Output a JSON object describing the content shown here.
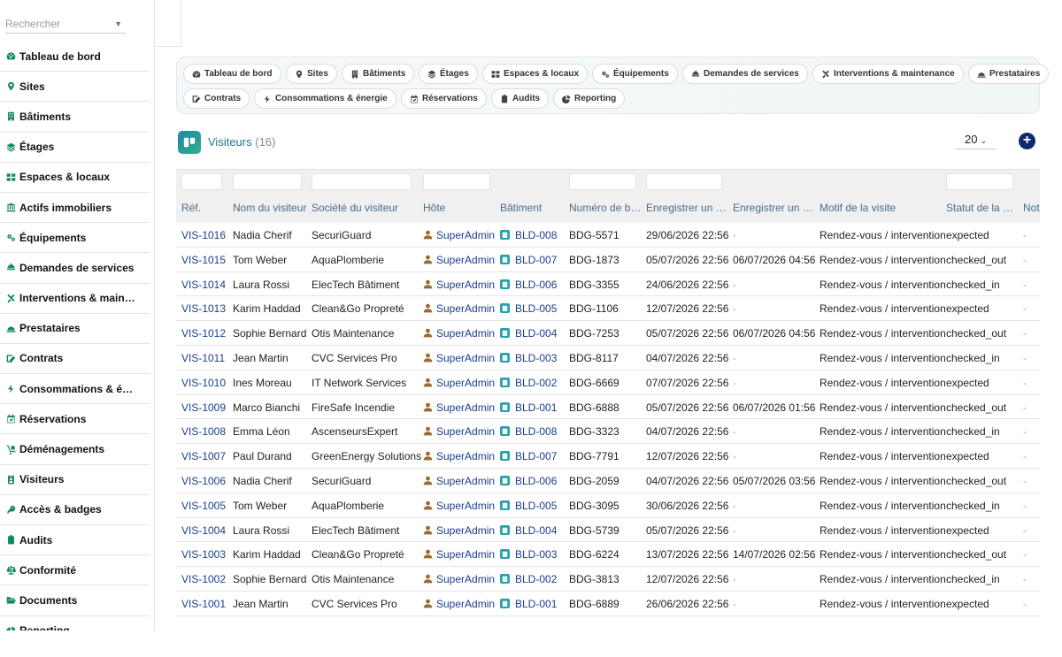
{
  "sidebar": {
    "search_placeholder": "Rechercher",
    "items": [
      {
        "label": "Tableau de bord",
        "icon": "dashboard-icon"
      },
      {
        "label": "Sites",
        "icon": "map-pin-icon"
      },
      {
        "label": "Bâtiments",
        "icon": "building-icon"
      },
      {
        "label": "Étages",
        "icon": "layers-icon"
      },
      {
        "label": "Espaces & locaux",
        "icon": "grid-icon"
      },
      {
        "label": "Actifs immobiliers",
        "icon": "bank-icon"
      },
      {
        "label": "Équipements",
        "icon": "gears-icon"
      },
      {
        "label": "Demandes de services",
        "icon": "bell-icon"
      },
      {
        "label": "Interventions & main…",
        "icon": "tools-icon"
      },
      {
        "label": "Prestataires",
        "icon": "helmet-icon"
      },
      {
        "label": "Contrats",
        "icon": "signature-icon"
      },
      {
        "label": "Consommations & é…",
        "icon": "bolt-icon"
      },
      {
        "label": "Réservations",
        "icon": "calendar-check-icon"
      },
      {
        "label": "Déménagements",
        "icon": "dolly-icon"
      },
      {
        "label": "Visiteurs",
        "icon": "id-badge-icon"
      },
      {
        "label": "Accès & badges",
        "icon": "key-icon"
      },
      {
        "label": "Audits",
        "icon": "clipboard-check-icon"
      },
      {
        "label": "Conformité",
        "icon": "scale-icon"
      },
      {
        "label": "Documents",
        "icon": "folder-open-icon"
      },
      {
        "label": "Reporting",
        "icon": "chart-pie-icon"
      }
    ]
  },
  "quicknav": {
    "items": [
      {
        "label": "Tableau de bord",
        "icon": "dashboard-icon"
      },
      {
        "label": "Sites",
        "icon": "map-pin-icon"
      },
      {
        "label": "Bâtiments",
        "icon": "building-icon"
      },
      {
        "label": "Étages",
        "icon": "layers-icon"
      },
      {
        "label": "Espaces & locaux",
        "icon": "grid-icon"
      },
      {
        "label": "Équipements",
        "icon": "gears-icon"
      },
      {
        "label": "Demandes de services",
        "icon": "bell-icon"
      },
      {
        "label": "Interventions & maintenance",
        "icon": "tools-icon"
      },
      {
        "label": "Prestataires",
        "icon": "helmet-icon"
      },
      {
        "label": "Contrats",
        "icon": "signature-icon"
      },
      {
        "label": "Consommations & énergie",
        "icon": "bolt-icon"
      },
      {
        "label": "Réservations",
        "icon": "calendar-check-icon"
      },
      {
        "label": "Audits",
        "icon": "clipboard-check-icon"
      },
      {
        "label": "Reporting",
        "icon": "chart-pie-icon"
      }
    ]
  },
  "list": {
    "title": "Visiteurs",
    "count": "(16)",
    "page_size": "20",
    "add_icon": "plus-circle-icon",
    "list_icon": "kanban-icon"
  },
  "table": {
    "columns": [
      "Réf.",
      "Nom du visiteur",
      "Société du visiteur",
      "Hôte",
      "Bâtiment",
      "Numéro de b…",
      "Enregistrer un …",
      "Enregistrer un …",
      "Motif de la visite",
      "Statut de la …",
      "Note"
    ],
    "rows": [
      [
        "VIS-1016",
        "Nadia Cherif",
        "SecuriGuard",
        "SuperAdmin",
        "BLD-008",
        "BDG-5571",
        "29/06/2026 22:56",
        "-",
        "Rendez-vous / intervention",
        "expected",
        "-"
      ],
      [
        "VIS-1015",
        "Tom Weber",
        "AquaPlomberie",
        "SuperAdmin",
        "BLD-007",
        "BDG-1873",
        "05/07/2026 22:56",
        "06/07/2026 04:56",
        "Rendez-vous / intervention",
        "checked_out",
        "-"
      ],
      [
        "VIS-1014",
        "Laura Rossi",
        "ElecTech Bâtiment",
        "SuperAdmin",
        "BLD-006",
        "BDG-3355",
        "24/06/2026 22:56",
        "-",
        "Rendez-vous / intervention",
        "checked_in",
        "-"
      ],
      [
        "VIS-1013",
        "Karim Haddad",
        "Clean&Go Propreté",
        "SuperAdmin",
        "BLD-005",
        "BDG-1106",
        "12/07/2026 22:56",
        "-",
        "Rendez-vous / intervention",
        "expected",
        "-"
      ],
      [
        "VIS-1012",
        "Sophie Bernard",
        "Otis Maintenance",
        "SuperAdmin",
        "BLD-004",
        "BDG-7253",
        "05/07/2026 22:56",
        "06/07/2026 04:56",
        "Rendez-vous / intervention",
        "checked_out",
        "-"
      ],
      [
        "VIS-1011",
        "Jean Martin",
        "CVC Services Pro",
        "SuperAdmin",
        "BLD-003",
        "BDG-8117",
        "04/07/2026 22:56",
        "-",
        "Rendez-vous / intervention",
        "checked_in",
        "-"
      ],
      [
        "VIS-1010",
        "Ines Moreau",
        "IT Network Services",
        "SuperAdmin",
        "BLD-002",
        "BDG-6669",
        "07/07/2026 22:56",
        "-",
        "Rendez-vous / intervention",
        "expected",
        "-"
      ],
      [
        "VIS-1009",
        "Marco Bianchi",
        "FireSafe Incendie",
        "SuperAdmin",
        "BLD-001",
        "BDG-6888",
        "05/07/2026 22:56",
        "06/07/2026 01:56",
        "Rendez-vous / intervention",
        "checked_out",
        "-"
      ],
      [
        "VIS-1008",
        "Emma Léon",
        "AscenseursExpert",
        "SuperAdmin",
        "BLD-008",
        "BDG-3323",
        "04/07/2026 22:56",
        "-",
        "Rendez-vous / intervention",
        "checked_in",
        "-"
      ],
      [
        "VIS-1007",
        "Paul Durand",
        "GreenEnergy Solutions",
        "SuperAdmin",
        "BLD-007",
        "BDG-7791",
        "12/07/2026 22:56",
        "-",
        "Rendez-vous / intervention",
        "expected",
        "-"
      ],
      [
        "VIS-1006",
        "Nadia Cherif",
        "SecuriGuard",
        "SuperAdmin",
        "BLD-006",
        "BDG-2059",
        "04/07/2026 22:56",
        "05/07/2026 03:56",
        "Rendez-vous / intervention",
        "checked_out",
        "-"
      ],
      [
        "VIS-1005",
        "Tom Weber",
        "AquaPlomberie",
        "SuperAdmin",
        "BLD-005",
        "BDG-3095",
        "30/06/2026 22:56",
        "-",
        "Rendez-vous / intervention",
        "checked_in",
        "-"
      ],
      [
        "VIS-1004",
        "Laura Rossi",
        "ElecTech Bâtiment",
        "SuperAdmin",
        "BLD-004",
        "BDG-5739",
        "05/07/2026 22:56",
        "-",
        "Rendez-vous / intervention",
        "expected",
        "-"
      ],
      [
        "VIS-1003",
        "Karim Haddad",
        "Clean&Go Propreté",
        "SuperAdmin",
        "BLD-003",
        "BDG-6224",
        "13/07/2026 22:56",
        "14/07/2026 02:56",
        "Rendez-vous / intervention",
        "checked_out",
        "-"
      ],
      [
        "VIS-1002",
        "Sophie Bernard",
        "Otis Maintenance",
        "SuperAdmin",
        "BLD-002",
        "BDG-3813",
        "12/07/2026 22:56",
        "-",
        "Rendez-vous / intervention",
        "checked_in",
        "-"
      ],
      [
        "VIS-1001",
        "Jean Martin",
        "CVC Services Pro",
        "SuperAdmin",
        "BLD-001",
        "BDG-6889",
        "26/06/2026 22:56",
        "-",
        "Rendez-vous / intervention",
        "expected",
        "-"
      ]
    ]
  },
  "colors": {
    "accent_green": "#138a5e",
    "link_blue": "#1a3d8f",
    "header_text": "#4a6a8a",
    "add_button": "#0e2a6e"
  }
}
